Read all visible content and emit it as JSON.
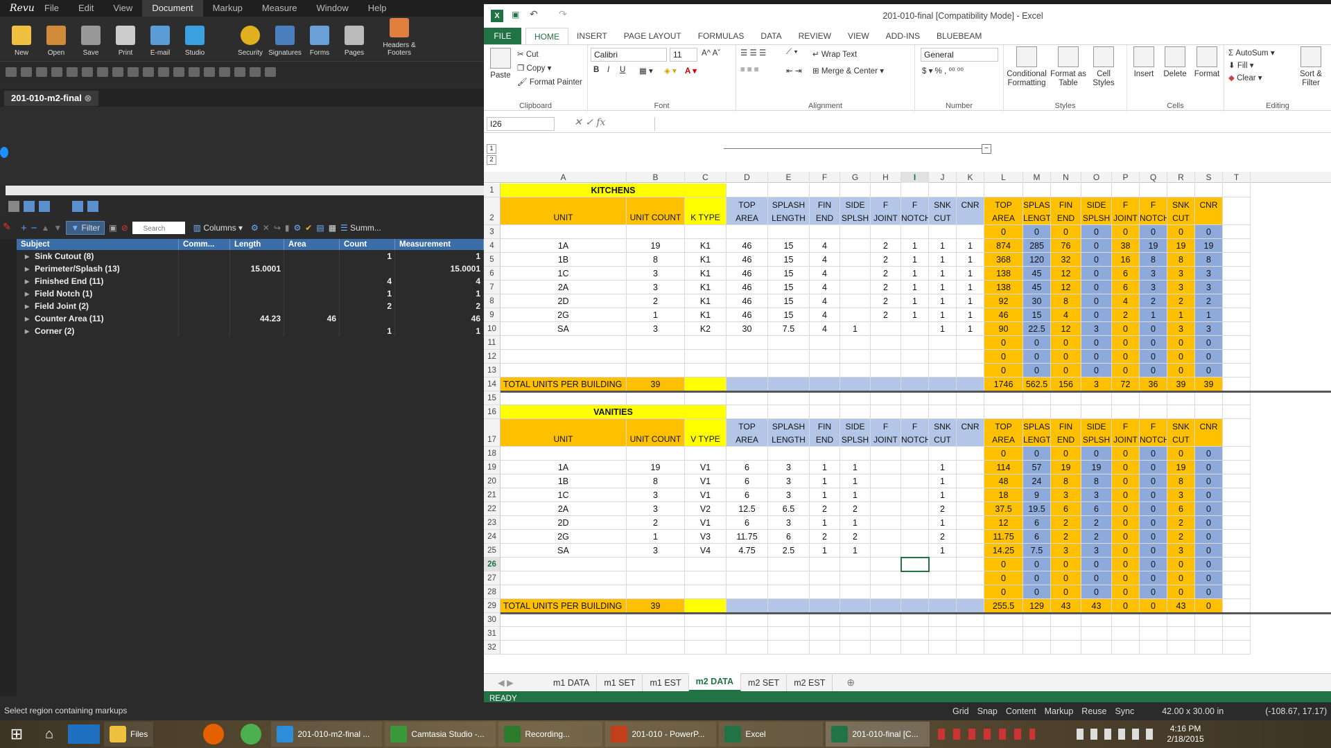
{
  "revu": {
    "menu": [
      "File",
      "Edit",
      "View",
      "Document",
      "Markup",
      "Measure",
      "Window",
      "Help"
    ],
    "logo": "Revu",
    "toolbar": [
      "New",
      "Open",
      "Save",
      "Print",
      "E-mail",
      "Studio",
      "Security",
      "Signatures",
      "Forms",
      "Pages",
      "Headers & Footers"
    ],
    "doc_tab": "201-010-m2-final",
    "listtools": {
      "filter": "Filter",
      "search_placeholder": "Search",
      "columns": "Columns",
      "summary": "Summ..."
    },
    "markups_headers": [
      "Subject",
      "Comm...",
      "Length",
      "Area",
      "Count",
      "Measurement"
    ],
    "markups": [
      {
        "subject": "Sink Cutout (8)",
        "comments": "",
        "length": "",
        "area": "",
        "count": "1",
        "measurement": "1"
      },
      {
        "subject": "Perimeter/Splash (13)",
        "comments": "",
        "length": "15.0001",
        "area": "",
        "count": "",
        "measurement": "15.0001"
      },
      {
        "subject": "Finished End (11)",
        "comments": "",
        "length": "",
        "area": "",
        "count": "4",
        "measurement": "4"
      },
      {
        "subject": "Field Notch (1)",
        "comments": "",
        "length": "",
        "area": "",
        "count": "1",
        "measurement": "1"
      },
      {
        "subject": "Field Joint (2)",
        "comments": "",
        "length": "",
        "area": "",
        "count": "2",
        "measurement": "2"
      },
      {
        "subject": "Counter Area (11)",
        "comments": "",
        "length": "44.23",
        "area": "46",
        "count": "",
        "measurement": "46"
      },
      {
        "subject": "Corner (2)",
        "comments": "",
        "length": "",
        "area": "",
        "count": "1",
        "measurement": "1"
      }
    ],
    "status": "Select region containing markups",
    "status_right": {
      "grid": "Grid",
      "snap": "Snap",
      "content": "Content",
      "markup": "Markup",
      "reuse": "Reuse",
      "sync": "Sync",
      "size": "42.00 x 30.00 in",
      "coords": "(-108.67, 17.17)"
    }
  },
  "excel": {
    "title": "201-010-final  [Compatibility Mode] - Excel",
    "tabs": [
      "FILE",
      "HOME",
      "INSERT",
      "PAGE LAYOUT",
      "FORMULAS",
      "DATA",
      "REVIEW",
      "VIEW",
      "ADD-INS",
      "BLUEBEAM"
    ],
    "ribbon": {
      "paste": "Paste",
      "cut": "Cut",
      "copy": "Copy",
      "format_painter": "Format Painter",
      "clipboard": "Clipboard",
      "font_name": "Calibri",
      "font_size": "11",
      "font": "Font",
      "wrap_text": "Wrap Text",
      "merge_center": "Merge & Center",
      "alignment": "Alignment",
      "number_format": "General",
      "number": "Number",
      "conditional": "Conditional Formatting",
      "format_table": "Format as Table",
      "cell_styles": "Cell Styles",
      "styles": "Styles",
      "insert": "Insert",
      "delete": "Delete",
      "format": "Format",
      "cells": "Cells",
      "autosum": "AutoSum",
      "fill": "Fill",
      "clear": "Clear",
      "sort": "Sort & Filter",
      "editing": "Editing"
    },
    "namebox": "I26",
    "columns": [
      "A",
      "B",
      "C",
      "D",
      "E",
      "F",
      "G",
      "H",
      "I",
      "J",
      "K",
      "L",
      "M",
      "N",
      "O",
      "P",
      "Q",
      "R",
      "S",
      "T"
    ],
    "kitchens": {
      "title": "KITCHENS",
      "headers": [
        "UNIT",
        "UNIT COUNT",
        "K TYPE",
        "TOP AREA",
        "SPLASH LENGTH",
        "FIN END",
        "SIDE SPLSH",
        "F JOINT",
        "F NOTCH",
        "SNK CUT",
        "CNR",
        "TOP AREA",
        "SPLASH LENGTH",
        "FIN END",
        "SIDE SPLSH",
        "F JOINT",
        "F NOTCH",
        "SNK CUT",
        "CNR"
      ],
      "rows": [
        [
          "",
          "",
          "",
          "",
          "",
          "",
          "",
          "",
          "",
          "",
          "",
          "0",
          "0",
          "0",
          "0",
          "0",
          "0",
          "0",
          "0"
        ],
        [
          "1A",
          "19",
          "K1",
          "46",
          "15",
          "4",
          "",
          "2",
          "1",
          "1",
          "1",
          "874",
          "285",
          "76",
          "0",
          "38",
          "19",
          "19",
          "19"
        ],
        [
          "1B",
          "8",
          "K1",
          "46",
          "15",
          "4",
          "",
          "2",
          "1",
          "1",
          "1",
          "368",
          "120",
          "32",
          "0",
          "16",
          "8",
          "8",
          "8"
        ],
        [
          "1C",
          "3",
          "K1",
          "46",
          "15",
          "4",
          "",
          "2",
          "1",
          "1",
          "1",
          "138",
          "45",
          "12",
          "0",
          "6",
          "3",
          "3",
          "3"
        ],
        [
          "2A",
          "3",
          "K1",
          "46",
          "15",
          "4",
          "",
          "2",
          "1",
          "1",
          "1",
          "138",
          "45",
          "12",
          "0",
          "6",
          "3",
          "3",
          "3"
        ],
        [
          "2D",
          "2",
          "K1",
          "46",
          "15",
          "4",
          "",
          "2",
          "1",
          "1",
          "1",
          "92",
          "30",
          "8",
          "0",
          "4",
          "2",
          "2",
          "2"
        ],
        [
          "2G",
          "1",
          "K1",
          "46",
          "15",
          "4",
          "",
          "2",
          "1",
          "1",
          "1",
          "46",
          "15",
          "4",
          "0",
          "2",
          "1",
          "1",
          "1"
        ],
        [
          "SA",
          "3",
          "K2",
          "30",
          "7.5",
          "4",
          "1",
          "",
          "",
          "1",
          "1",
          "90",
          "22.5",
          "12",
          "3",
          "0",
          "0",
          "3",
          "3"
        ],
        [
          "",
          "",
          "",
          "",
          "",
          "",
          "",
          "",
          "",
          "",
          "",
          "0",
          "0",
          "0",
          "0",
          "0",
          "0",
          "0",
          "0"
        ],
        [
          "",
          "",
          "",
          "",
          "",
          "",
          "",
          "",
          "",
          "",
          "",
          "0",
          "0",
          "0",
          "0",
          "0",
          "0",
          "0",
          "0"
        ],
        [
          "",
          "",
          "",
          "",
          "",
          "",
          "",
          "",
          "",
          "",
          "",
          "0",
          "0",
          "0",
          "0",
          "0",
          "0",
          "0",
          "0"
        ]
      ],
      "total": [
        "TOTAL UNITS PER BUILDING",
        "39",
        "",
        "",
        "",
        "",
        "",
        "",
        "",
        "",
        "",
        "1746",
        "562.5",
        "156",
        "3",
        "72",
        "36",
        "39",
        "39"
      ]
    },
    "vanities": {
      "title": "VANITIES",
      "headers": [
        "UNIT",
        "UNIT COUNT",
        "V TYPE",
        "TOP AREA",
        "SPLASH LENGTH",
        "FIN END",
        "SIDE SPLSH",
        "F JOINT",
        "F NOTCH",
        "SNK CUT",
        "CNR",
        "TOP AREA",
        "SPLASH LENGTH",
        "FIN END",
        "SIDE SPLSH",
        "F JOINT",
        "F NOTCH",
        "SNK CUT",
        "CNR"
      ],
      "rows": [
        [
          "",
          "",
          "",
          "",
          "",
          "",
          "",
          "",
          "",
          "",
          "",
          "0",
          "0",
          "0",
          "0",
          "0",
          "0",
          "0",
          "0"
        ],
        [
          "1A",
          "19",
          "V1",
          "6",
          "3",
          "1",
          "1",
          "",
          "",
          "1",
          "",
          "114",
          "57",
          "19",
          "19",
          "0",
          "0",
          "19",
          "0"
        ],
        [
          "1B",
          "8",
          "V1",
          "6",
          "3",
          "1",
          "1",
          "",
          "",
          "1",
          "",
          "48",
          "24",
          "8",
          "8",
          "0",
          "0",
          "8",
          "0"
        ],
        [
          "1C",
          "3",
          "V1",
          "6",
          "3",
          "1",
          "1",
          "",
          "",
          "1",
          "",
          "18",
          "9",
          "3",
          "3",
          "0",
          "0",
          "3",
          "0"
        ],
        [
          "2A",
          "3",
          "V2",
          "12.5",
          "6.5",
          "2",
          "2",
          "",
          "",
          "2",
          "",
          "37.5",
          "19.5",
          "6",
          "6",
          "0",
          "0",
          "6",
          "0"
        ],
        [
          "2D",
          "2",
          "V1",
          "6",
          "3",
          "1",
          "1",
          "",
          "",
          "1",
          "",
          "12",
          "6",
          "2",
          "2",
          "0",
          "0",
          "2",
          "0"
        ],
        [
          "2G",
          "1",
          "V3",
          "11.75",
          "6",
          "2",
          "2",
          "",
          "",
          "2",
          "",
          "11.75",
          "6",
          "2",
          "2",
          "0",
          "0",
          "2",
          "0"
        ],
        [
          "SA",
          "3",
          "V4",
          "4.75",
          "2.5",
          "1",
          "1",
          "",
          "",
          "1",
          "",
          "14.25",
          "7.5",
          "3",
          "3",
          "0",
          "0",
          "3",
          "0"
        ],
        [
          "",
          "",
          "",
          "",
          "",
          "",
          "",
          "",
          "",
          "",
          "",
          "0",
          "0",
          "0",
          "0",
          "0",
          "0",
          "0",
          "0"
        ],
        [
          "",
          "",
          "",
          "",
          "",
          "",
          "",
          "",
          "",
          "",
          "",
          "0",
          "0",
          "0",
          "0",
          "0",
          "0",
          "0",
          "0"
        ],
        [
          "",
          "",
          "",
          "",
          "",
          "",
          "",
          "",
          "",
          "",
          "",
          "0",
          "0",
          "0",
          "0",
          "0",
          "0",
          "0",
          "0"
        ]
      ],
      "total": [
        "TOTAL UNITS PER BUILDING",
        "39",
        "",
        "",
        "",
        "",
        "",
        "",
        "",
        "",
        "",
        "255.5",
        "129",
        "43",
        "43",
        "0",
        "0",
        "43",
        "0"
      ]
    },
    "sheets": [
      "m1 DATA",
      "m1 SET",
      "m1 EST",
      "m2 DATA",
      "m2 SET",
      "m2 EST"
    ],
    "active_sheet": "m2 DATA",
    "status": "READY"
  },
  "taskbar": {
    "items": [
      "Files",
      "201-010-m2-final ...",
      "Camtasia Studio -...",
      "Recording...",
      "201-010 - PowerP...",
      "Excel",
      "201-010-final [C..."
    ],
    "time": "4:16 PM",
    "date": "2/18/2015"
  }
}
